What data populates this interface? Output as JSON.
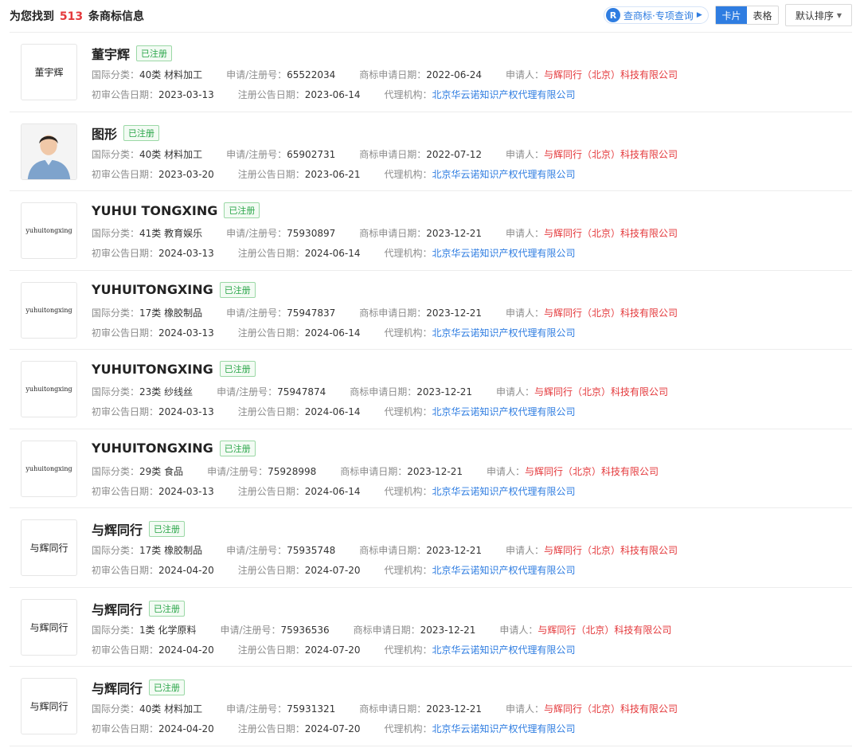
{
  "header": {
    "result_prefix": "为您找到",
    "result_count": "513",
    "result_suffix": "条商标信息",
    "query_icon": "R",
    "query_label": "查商标·专项查询",
    "view_card": "卡片",
    "view_table": "表格",
    "sort_label": "默认排序"
  },
  "labels": {
    "class": "国际分类：",
    "reg_no": "申请/注册号：",
    "apply_date": "商标申请日期：",
    "applicant": "申请人：",
    "first_pub": "初审公告日期：",
    "reg_pub": "注册公告日期：",
    "agency": "代理机构："
  },
  "items": [
    {
      "thumb": "董宇辉",
      "name": "董宇辉",
      "status": "已注册",
      "class": "40类 材料加工",
      "reg_no": "65522034",
      "apply_date": "2022-06-24",
      "applicant": "与辉同行（北京）科技有限公司",
      "first_pub": "2023-03-13",
      "reg_pub": "2023-06-14",
      "agency": "北京华云诺知识产权代理有限公司"
    },
    {
      "thumb": "",
      "name": "图形",
      "status": "已注册",
      "class": "40类 材料加工",
      "reg_no": "65902731",
      "apply_date": "2022-07-12",
      "applicant": "与辉同行（北京）科技有限公司",
      "first_pub": "2023-03-20",
      "reg_pub": "2023-06-21",
      "agency": "北京华云诺知识产权代理有限公司"
    },
    {
      "thumb": "yuhuitongxing",
      "name": "YUHUI TONGXING",
      "status": "已注册",
      "class": "41类 教育娱乐",
      "reg_no": "75930897",
      "apply_date": "2023-12-21",
      "applicant": "与辉同行（北京）科技有限公司",
      "first_pub": "2024-03-13",
      "reg_pub": "2024-06-14",
      "agency": "北京华云诺知识产权代理有限公司"
    },
    {
      "thumb": "yuhuitongxing",
      "name": "YUHUITONGXING",
      "status": "已注册",
      "class": "17类 橡胶制品",
      "reg_no": "75947837",
      "apply_date": "2023-12-21",
      "applicant": "与辉同行（北京）科技有限公司",
      "first_pub": "2024-03-13",
      "reg_pub": "2024-06-14",
      "agency": "北京华云诺知识产权代理有限公司"
    },
    {
      "thumb": "yuhuitongxing",
      "name": "YUHUITONGXING",
      "status": "已注册",
      "class": "23类 纱线丝",
      "reg_no": "75947874",
      "apply_date": "2023-12-21",
      "applicant": "与辉同行（北京）科技有限公司",
      "first_pub": "2024-03-13",
      "reg_pub": "2024-06-14",
      "agency": "北京华云诺知识产权代理有限公司"
    },
    {
      "thumb": "yuhuitongxing",
      "name": "YUHUITONGXING",
      "status": "已注册",
      "class": "29类 食品",
      "reg_no": "75928998",
      "apply_date": "2023-12-21",
      "applicant": "与辉同行（北京）科技有限公司",
      "first_pub": "2024-03-13",
      "reg_pub": "2024-06-14",
      "agency": "北京华云诺知识产权代理有限公司"
    },
    {
      "thumb": "与辉同行",
      "name": "与辉同行",
      "status": "已注册",
      "class": "17类 橡胶制品",
      "reg_no": "75935748",
      "apply_date": "2023-12-21",
      "applicant": "与辉同行（北京）科技有限公司",
      "first_pub": "2024-04-20",
      "reg_pub": "2024-07-20",
      "agency": "北京华云诺知识产权代理有限公司"
    },
    {
      "thumb": "与辉同行",
      "name": "与辉同行",
      "status": "已注册",
      "class": "1类 化学原料",
      "reg_no": "75936536",
      "apply_date": "2023-12-21",
      "applicant": "与辉同行（北京）科技有限公司",
      "first_pub": "2024-04-20",
      "reg_pub": "2024-07-20",
      "agency": "北京华云诺知识产权代理有限公司"
    },
    {
      "thumb": "与辉同行",
      "name": "与辉同行",
      "status": "已注册",
      "class": "40类 材料加工",
      "reg_no": "75931321",
      "apply_date": "2023-12-21",
      "applicant": "与辉同行（北京）科技有限公司",
      "first_pub": "2024-04-20",
      "reg_pub": "2024-07-20",
      "agency": "北京华云诺知识产权代理有限公司"
    }
  ],
  "colors": {
    "accent": "#2f7de1",
    "highlight": "#e4393c",
    "status": "#2ba64a"
  }
}
